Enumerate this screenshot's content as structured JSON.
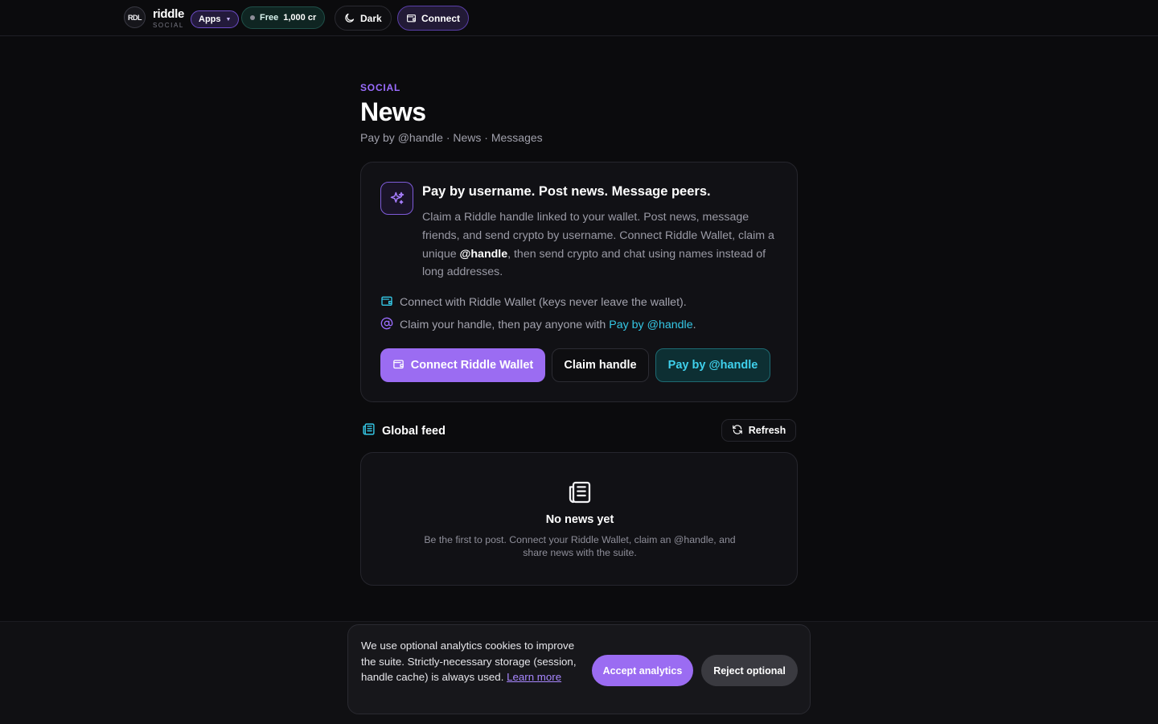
{
  "topbar": {
    "logo_text": "RDL",
    "brand_name": "riddle",
    "brand_sub": "SOCIAL",
    "apps_label": "Apps",
    "free_label": "Free",
    "credits": "1,000 cr",
    "theme_label": "Dark",
    "connect_label": "Connect"
  },
  "header": {
    "eyebrow": "SOCIAL",
    "title": "News",
    "subtitle": "Pay by @handle · News · Messages"
  },
  "intro": {
    "heading": "Pay by username. Post news. Message peers.",
    "body_part1": "Claim a Riddle handle linked to your wallet. Post news, message friends, and send crypto by username. Connect Riddle Wallet, claim a unique ",
    "body_highlight": "@handle",
    "body_part2": ", then send crypto and chat using names instead of long addresses.",
    "feature1": "Connect with Riddle Wallet (keys never leave the wallet).",
    "feature2_prefix": "Claim your handle, then pay anyone with ",
    "feature2_link": "Pay by @handle",
    "feature2_suffix": ".",
    "btn_connect": "Connect Riddle Wallet",
    "btn_claim": "Claim handle",
    "btn_pay": "Pay by @handle"
  },
  "feed": {
    "title": "Global feed",
    "refresh_label": "Refresh",
    "empty_title": "No news yet",
    "empty_text": "Be the first to post. Connect your Riddle Wallet, claim an @handle, and share news with the suite."
  },
  "cookie": {
    "text": "We use optional analytics cookies to improve the suite. Strictly-necessary storage (session, handle cache) is always used.",
    "learn_more": "Learn more",
    "accept_label": "Accept analytics",
    "reject_label": "Reject optional"
  },
  "colors": {
    "accent_purple": "#9b6cf2",
    "accent_cyan": "#35c8e6",
    "background": "#0b0b0d"
  },
  "icons": [
    "logo-badge",
    "caret-down-icon",
    "status-dot-icon",
    "moon-icon",
    "wallet-icon",
    "sparkle-icon",
    "at-icon",
    "newspaper-icon",
    "refresh-icon"
  ]
}
